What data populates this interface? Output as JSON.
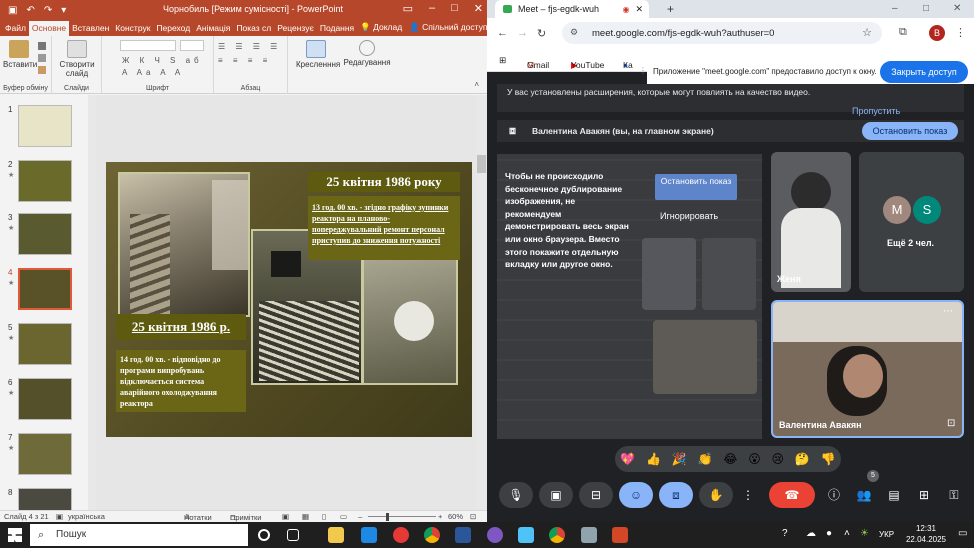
{
  "powerpoint": {
    "quick_access": {
      "file": "Файл",
      "save_icon": "save-icon",
      "undo_icon": "undo-icon",
      "redo_icon": "redo-icon"
    },
    "title": "Чорнобиль [Режим сумісності] - PowerPoint",
    "tabs": [
      "Основне",
      "Вставлен",
      "Конструк",
      "Переход",
      "Анімація",
      "Показ сл",
      "Рецензує",
      "Подання"
    ],
    "active_tab": "Основне",
    "tell_me": "Доклад",
    "share": "Спільний доступ",
    "ribbon": {
      "paste": "Вставити",
      "new_slide": "Створити слайд",
      "drawing": "Кресленння",
      "editing": "Редагування",
      "groups": [
        "Буфер обміну",
        "Слайди",
        "Шрифт",
        "Абзац"
      ]
    },
    "thumbnails": [
      {
        "num": "1"
      },
      {
        "num": "2"
      },
      {
        "num": "3"
      },
      {
        "num": "4",
        "selected": true
      },
      {
        "num": "5"
      },
      {
        "num": "6"
      },
      {
        "num": "7"
      },
      {
        "num": "8"
      }
    ],
    "slide": {
      "heading1": "25 квітня 1986 року",
      "text1": "13 год. 00 хв. - згідно графіку зупинки реактора на планово-попереджувальний ремонт персонал приступив до зниження потужності",
      "heading2": "25 квітня 1986 р.",
      "text2": "14 год. 00 хв. - відповідно до програми випробувань відключається система аварійного охолоджування реактора"
    },
    "status": {
      "slide_of": "Слайд 4 з 21",
      "language": "українська",
      "notes": "Нотатки",
      "comments": "Примітки",
      "zoom": "60%"
    }
  },
  "browser": {
    "tab_title": "Meet – fjs-egdk-wuh",
    "url": "meet.google.com/fjs-egdk-wuh?authuser=0",
    "profile_initial": "B",
    "bookmarks": [
      "Gmail",
      "YouTube",
      "Ка"
    ],
    "infobar": {
      "text": "Приложение \"meet.google.com\" предоставило доступ к окну.",
      "button": "Закрыть доступ"
    }
  },
  "meet": {
    "ext_warning": "У вас установлены расширения, которые могут повлиять на качество видео.",
    "skip": "Пропустить",
    "presenting": "Валентина Авакян (вы, на главном экране)",
    "stop_presenting": "Остановить показ",
    "mirror_warning": "Чтобы не происходило бесконечное дублирование изображения, не рекомендуем демонстрировать весь экран или окно браузера. Вместо этого покажите отдельную вкладку или другое окно.",
    "mirror_stop": "Остановить показ",
    "mirror_ignore": "Игнорировать",
    "tiles": {
      "zhenya": "Женя",
      "more_avatars": [
        "M",
        "S"
      ],
      "more": "Ещё 2 чел.",
      "self": "Валентина Авакян"
    },
    "reactions": [
      "💖",
      "👍",
      "🎉",
      "👏",
      "😂",
      "😮",
      "😢",
      "🤔",
      "👎"
    ],
    "participants_count": "5",
    "colors": {
      "accent": "#8ab4f8",
      "end_call": "#ea4335",
      "present": "#8ab4f8"
    }
  },
  "taskbar": {
    "search_placeholder": "Пошук",
    "lang": "УКР",
    "time": "12:31",
    "date": "22.04.2025"
  }
}
